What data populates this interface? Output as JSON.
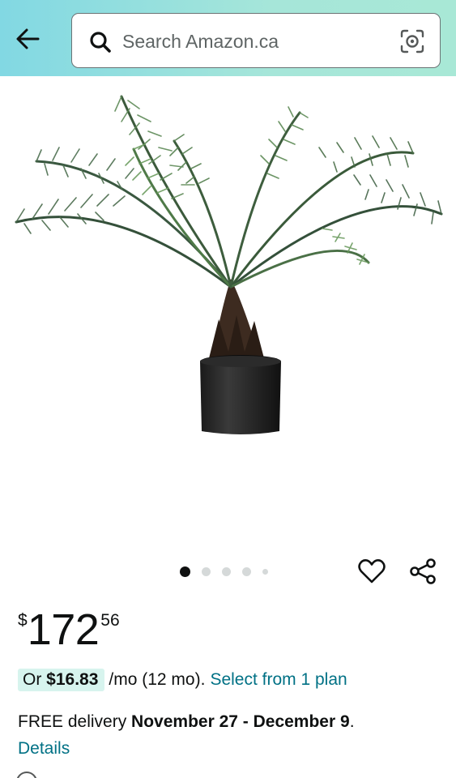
{
  "header": {
    "back_icon": "arrow-left-icon",
    "search": {
      "placeholder": "Search Amazon.ca",
      "value": ""
    },
    "search_icon": "search-icon",
    "camera_icon": "camera-lens-icon"
  },
  "product": {
    "image_description_icon": "potted-palm-plant-image",
    "carousel": {
      "total": 5,
      "active_index": 0
    },
    "price": {
      "symbol": "$",
      "whole": "172",
      "fraction": "56"
    },
    "financing": {
      "prefix": "Or",
      "amount": "$16.83",
      "suffix": "/mo (12 mo).",
      "link": "Select from 1 plan"
    },
    "delivery": {
      "prefix": "FREE delivery",
      "dates": "November 27 - December 9",
      "period": ".",
      "details_link": "Details"
    }
  },
  "actions": {
    "wishlist_icon": "heart-icon",
    "share_icon": "share-icon"
  },
  "colors": {
    "header_gradient_start": "#82d8e3",
    "header_gradient_end": "#a8e8d6",
    "link": "#007185",
    "financing_pill": "#d7f4ee"
  }
}
